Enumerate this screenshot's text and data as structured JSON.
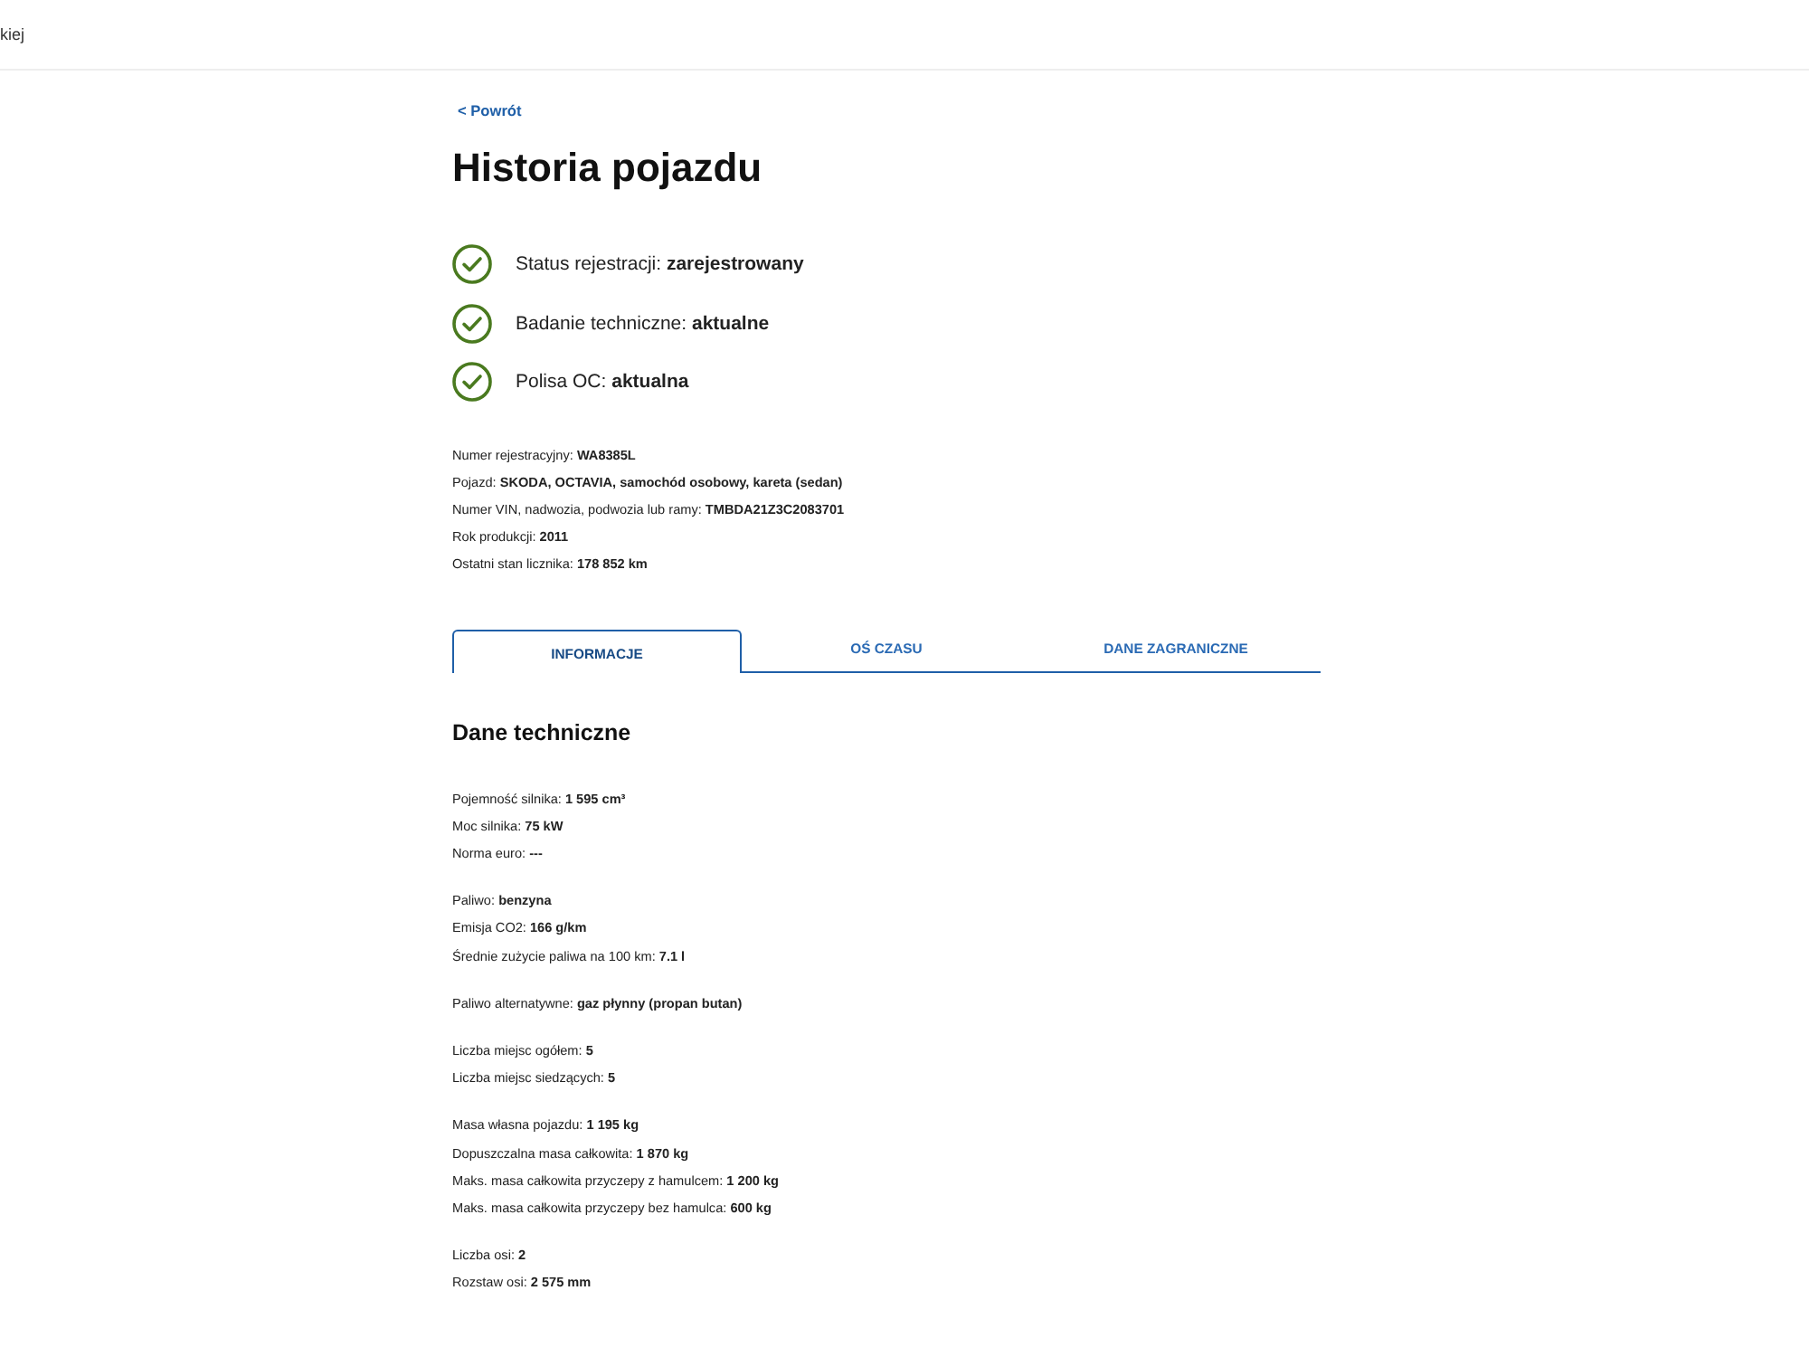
{
  "header": {
    "text": "kiej"
  },
  "back_link": "< Powrót",
  "title": "Historia pojazdu",
  "statuses": [
    {
      "text": "Status rejestracji: **zarejestrowany**",
      "ok": true
    },
    {
      "text": "Badanie techniczne: **aktualne**",
      "ok": true
    },
    {
      "text": "Polisa OC: **aktualna**",
      "ok": true
    }
  ],
  "vehicle_details": [
    "Numer rejestracyjny: **WA8385L**",
    "Pojazd: **SKODA, OCTAVIA, samochód osobowy, kareta (sedan)**",
    "Numer VIN, nadwozia, podwozia lub ramy: **TMBDA21Z3C2083701**",
    "Rok produkcji: **2011**",
    "Ostatni stan licznika: **178 852 km**"
  ],
  "tabs": [
    {
      "label": "INFORMACJE",
      "selected": true
    },
    {
      "label": "OŚ CZASU",
      "selected": false
    },
    {
      "label": "DANE ZAGRANICZNE",
      "selected": false
    }
  ],
  "section": {
    "title": "Dane techniczne",
    "groups": [
      [
        "Pojemność silnika: **1 595 cm³**",
        "Moc silnika: **75 kW**",
        "Norma euro: **---**"
      ],
      [
        "Paliwo: **benzyna**",
        "Emisja CO2: **166 g/km**",
        "Średnie zużycie paliwa na 100 km: **7.1 l**"
      ],
      [
        "Paliwo alternatywne: **gaz płynny (propan butan)**"
      ],
      [
        "Liczba miejsc ogółem: **5**",
        "Liczba miejsc siedzących: **5**"
      ],
      [
        "Masa własna pojazdu: **1 195 kg**",
        "Dopuszczalna masa całkowita: **1 870 kg**",
        "Maks. masa całkowita przyczepy z hamulcem: **1 200 kg**",
        "Maks. masa całkowita przyczepy bez hamulca: **600 kg**"
      ],
      [
        "Liczba osi: **2**",
        "Rozstaw osi: **2 575 mm**"
      ]
    ]
  }
}
